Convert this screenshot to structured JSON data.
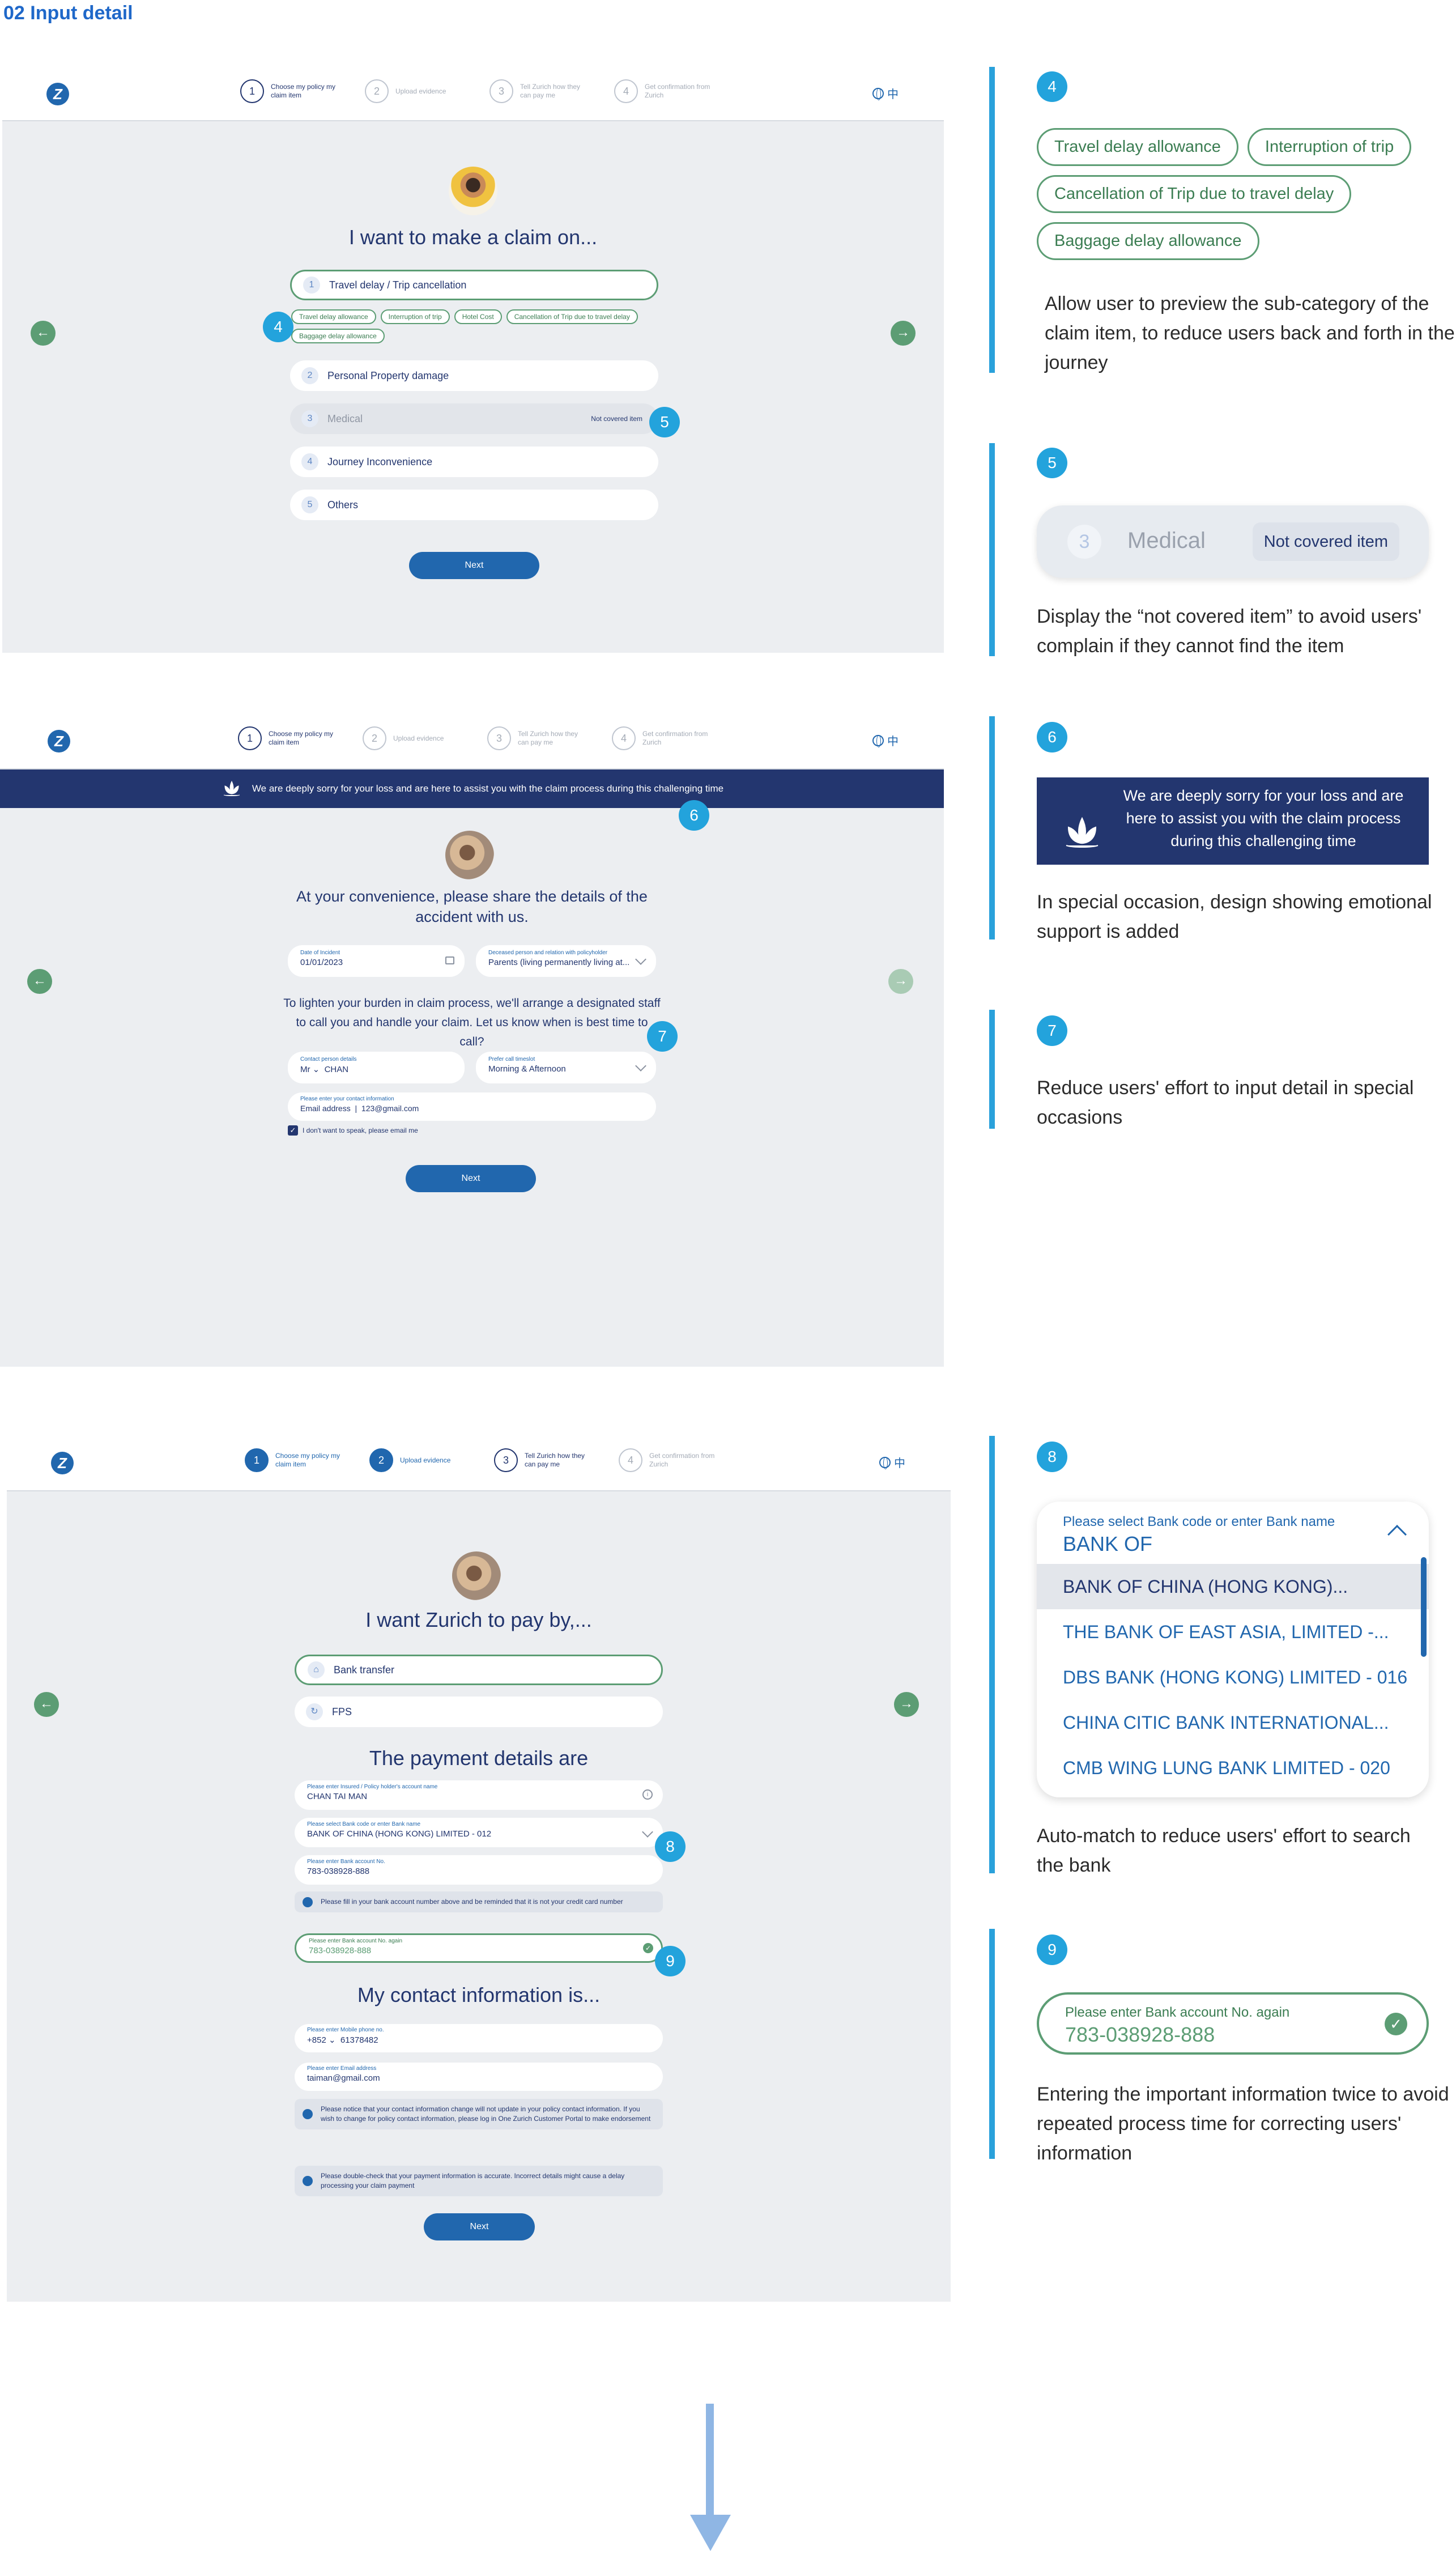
{
  "page_title": "02 Input detail",
  "nav": {
    "steps": [
      {
        "num": "1",
        "label": "Choose my policy my claim item"
      },
      {
        "num": "2",
        "label": "Upload evidence"
      },
      {
        "num": "3",
        "label": "Tell Zurich how they can pay me"
      },
      {
        "num": "4",
        "label": "Get confirmation from Zurich"
      }
    ],
    "lang": "中",
    "logo": "Z"
  },
  "screen1": {
    "heading": "I want to make a claim on...",
    "items": [
      {
        "icon": "1",
        "label": "Travel delay / Trip cancellation"
      },
      {
        "icon": "2",
        "label": "Personal Property damage"
      },
      {
        "icon": "3",
        "label": "Medical",
        "note": "Not covered item"
      },
      {
        "icon": "4",
        "label": "Journey Inconvenience"
      },
      {
        "icon": "5",
        "label": "Others"
      }
    ],
    "chips": [
      "Travel delay allowance",
      "Interruption of trip",
      "Hotel Cost",
      "Cancellation of Trip due to travel delay",
      "Baggage delay allowance"
    ],
    "next": "Next"
  },
  "screen2": {
    "banner": "We are deeply sorry for your loss and are here to assist you with the claim process during this challenging time",
    "heading": "At your convenience, please share the details of the accident with us.",
    "date_label": "Date of Incident",
    "date_value": "01/01/2023",
    "relation_label": "Deceased person and relation with policyholder",
    "relation_value": "Parents (living permanently living at...",
    "subheading": "To lighten your burden in claim process, we'll arrange a designated staff to call you and handle your claim. Let us know when is best time to call?",
    "contact_label": "Contact person details",
    "contact_title": "Mr",
    "contact_name": "CHAN",
    "time_label": "Prefer call timeslot",
    "time_value": "Morning & Afternoon",
    "email_label": "Please enter your contact information",
    "email_prefix": "Email address",
    "email_value": "123@gmail.com",
    "checkbox_label": "I don't want to speak, please email me",
    "next": "Next"
  },
  "screen3": {
    "heading": "I want Zurich to pay by,...",
    "method_1": "Bank transfer",
    "method_2": "FPS",
    "payment_heading": "The payment details are",
    "account_name_label": "Please enter Insured / Policy holder's account name",
    "account_name": "CHAN TAI MAN",
    "bank_label": "Please select Bank code or enter Bank name",
    "bank_value": "BANK OF CHINA (HONG KONG) LIMITED - 012",
    "acc_label": "Please enter Bank account No.",
    "acc_value": "783-038928-888",
    "acc_note": "Please fill in your bank account number above and be reminded that it is not your credit card number",
    "acc2_label": "Please enter Bank account No. again",
    "acc2_value": "783-038928-888",
    "contact_heading": "My contact information is...",
    "phone_label": "Please enter Mobile phone no.",
    "phone_code": "+852",
    "phone_value": "61378482",
    "email_label": "Please enter Email address",
    "email_value": "taiman@gmail.com",
    "note_1": "Please notice that your contact information change will not update in your policy contact information. If you wish to change for policy contact information, please log in One Zurich Customer Portal to make endorsement",
    "note_2": "Please double-check that your payment information is accurate. Incorrect details might cause a delay processing your claim payment",
    "next": "Next"
  },
  "badges": [
    "4",
    "5",
    "6",
    "7",
    "8",
    "9"
  ],
  "right": {
    "p4": {
      "chips": [
        "Travel delay allowance",
        "Interruption of trip",
        "Cancellation of Trip due to travel delay",
        "Baggage delay allowance"
      ],
      "desc": "Allow user to preview the sub-category of the claim item, to reduce users back and forth in the journey"
    },
    "p5": {
      "icon": "3",
      "label": "Medical",
      "tag": "Not covered item",
      "desc": "Display the “not covered item” to avoid users' complain if they cannot find the item"
    },
    "p6": {
      "banner": "We are deeply sorry for your loss and are here to assist you with the claim process during this challenging time",
      "desc": "In special occasion, design showing emotional support is added"
    },
    "p7": {
      "desc": "Reduce users' effort to input detail in special occasions"
    },
    "p8": {
      "label": "Please select Bank code or enter Bank name",
      "value": "BANK OF",
      "options": [
        "BANK OF CHINA (HONG KONG)...",
        "THE BANK OF EAST ASIA, LIMITED -...",
        "DBS BANK (HONG KONG) LIMITED - 016",
        "CHINA CITIC BANK INTERNATIONAL...",
        "CMB WING LUNG BANK LIMITED - 020"
      ],
      "desc": "Auto-match to reduce users' effort to search the bank"
    },
    "p9": {
      "label": "Please enter Bank account No. again",
      "value": "783-038928-888",
      "desc": "Entering the important information twice to avoid repeated process time for correcting users' information"
    }
  }
}
